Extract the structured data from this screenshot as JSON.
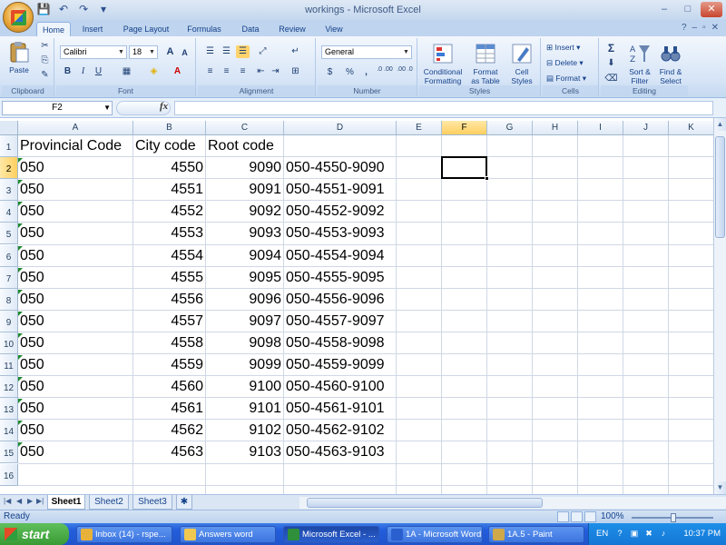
{
  "window": {
    "title": "workings - Microsoft Excel",
    "controls": [
      "–",
      "□",
      "✕"
    ]
  },
  "qat": {
    "save_icon": "💾",
    "undo_icon": "↶",
    "redo_icon": "↷",
    "more_icon": "▾"
  },
  "tabs": [
    {
      "label": "Home",
      "active": true
    },
    {
      "label": "Insert"
    },
    {
      "label": "Page Layout"
    },
    {
      "label": "Formulas"
    },
    {
      "label": "Data"
    },
    {
      "label": "Review"
    },
    {
      "label": "View"
    }
  ],
  "ribbon_controls": {
    "help": "?",
    "minimize": "–",
    "restore": "▫",
    "close": "✕"
  },
  "ribbon": {
    "clipboard": {
      "label": "Clipboard",
      "paste": "Paste"
    },
    "font": {
      "label": "Font",
      "font_name": "Calibri",
      "font_size": "18",
      "bold": "B",
      "italic": "I",
      "underline": "U",
      "grow": "A",
      "shrink": "A"
    },
    "alignment": {
      "label": "Alignment"
    },
    "number": {
      "label": "Number",
      "format": "General",
      "currency": "$",
      "percent": "%",
      "comma": ",",
      "inc_dec": ".0 .00",
      "dec_dec": ".00 .0"
    },
    "styles": {
      "label": "Styles",
      "conditional_1": "Conditional",
      "conditional_2": "Formatting",
      "format_table_1": "Format",
      "format_table_2": "as Table",
      "cell_styles_1": "Cell",
      "cell_styles_2": "Styles"
    },
    "cells": {
      "label": "Cells",
      "insert": "Insert",
      "delete": "Delete",
      "format": "Format"
    },
    "editing": {
      "label": "Editing",
      "sigma": "Σ",
      "sort_1": "Sort &",
      "sort_2": "Filter",
      "find_1": "Find &",
      "find_2": "Select"
    }
  },
  "formula_bar": {
    "name_box": "F2",
    "fx": "fx",
    "value": ""
  },
  "columns": [
    {
      "label": "A",
      "w": 127
    },
    {
      "label": "B",
      "w": 80
    },
    {
      "label": "C",
      "w": 86
    },
    {
      "label": "D",
      "w": 124
    },
    {
      "label": "E",
      "w": 50
    },
    {
      "label": "F",
      "w": 50
    },
    {
      "label": "G",
      "w": 50
    },
    {
      "label": "H",
      "w": 50
    },
    {
      "label": "I",
      "w": 50
    },
    {
      "label": "J",
      "w": 50
    },
    {
      "label": "K",
      "w": 50
    }
  ],
  "rows": [
    {
      "n": "1",
      "a": "Provincial Code",
      "b": "City code",
      "c": "Root code",
      "d": ""
    },
    {
      "n": "2",
      "a": "050",
      "b": "4550",
      "c": "9090",
      "d": "050-4550-9090"
    },
    {
      "n": "3",
      "a": "050",
      "b": "4551",
      "c": "9091",
      "d": "050-4551-9091"
    },
    {
      "n": "4",
      "a": "050",
      "b": "4552",
      "c": "9092",
      "d": "050-4552-9092"
    },
    {
      "n": "5",
      "a": "050",
      "b": "4553",
      "c": "9093",
      "d": "050-4553-9093"
    },
    {
      "n": "6",
      "a": "050",
      "b": "4554",
      "c": "9094",
      "d": "050-4554-9094"
    },
    {
      "n": "7",
      "a": "050",
      "b": "4555",
      "c": "9095",
      "d": "050-4555-9095"
    },
    {
      "n": "8",
      "a": "050",
      "b": "4556",
      "c": "9096",
      "d": "050-4556-9096"
    },
    {
      "n": "9",
      "a": "050",
      "b": "4557",
      "c": "9097",
      "d": "050-4557-9097"
    },
    {
      "n": "10",
      "a": "050",
      "b": "4558",
      "c": "9098",
      "d": "050-4558-9098"
    },
    {
      "n": "11",
      "a": "050",
      "b": "4559",
      "c": "9099",
      "d": "050-4559-9099"
    },
    {
      "n": "12",
      "a": "050",
      "b": "4560",
      "c": "9100",
      "d": "050-4560-9100"
    },
    {
      "n": "13",
      "a": "050",
      "b": "4561",
      "c": "9101",
      "d": "050-4561-9101"
    },
    {
      "n": "14",
      "a": "050",
      "b": "4562",
      "c": "9102",
      "d": "050-4562-9102"
    },
    {
      "n": "15",
      "a": "050",
      "b": "4563",
      "c": "9103",
      "d": "050-4563-9103"
    },
    {
      "n": "16",
      "a": "",
      "b": "",
      "c": "",
      "d": ""
    }
  ],
  "selected_cell": {
    "col": "F",
    "row": "2"
  },
  "sheets": [
    {
      "label": "Sheet1",
      "active": true
    },
    {
      "label": "Sheet2"
    },
    {
      "label": "Sheet3"
    }
  ],
  "status": {
    "text": "Ready",
    "zoom": "100%"
  },
  "taskbar": {
    "start": "start",
    "items": [
      {
        "label": "Inbox (14) - rspe...",
        "color": "#e8b23a"
      },
      {
        "label": "Answers word",
        "color": "#f0c850"
      },
      {
        "label": "Microsoft Excel - ...",
        "color": "#2f8f3a",
        "active": true
      },
      {
        "label": "1A - Microsoft Word",
        "color": "#2a5fcf"
      },
      {
        "label": "1A.5 - Paint",
        "color": "#cfa84a"
      }
    ],
    "tray_lang": "EN",
    "clock": "10:37 PM"
  },
  "colors": {
    "accent": "#15428b",
    "ribbon": "#d7e5f7",
    "selection": "#ffcf5f",
    "taskbar": "#245edc"
  }
}
